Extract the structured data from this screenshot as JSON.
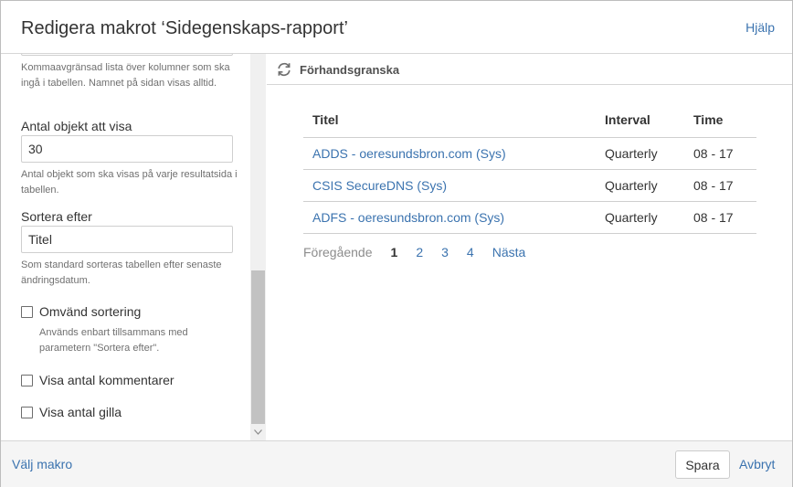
{
  "header": {
    "title": "Redigera makrot ‘Sidegenskaps-rapport’",
    "help": "Hjälp"
  },
  "left": {
    "columns_desc": "Kommaavgränsad lista över kolumner som ska ingå i tabellen. Namnet på sidan visas alltid.",
    "count_label": "Antal objekt att visa",
    "count_value": "30",
    "count_desc": "Antal objekt som ska visas på varje resultatsida i tabellen.",
    "sort_label": "Sortera efter",
    "sort_value": "Titel",
    "sort_desc": "Som standard sorteras tabellen efter senaste ändringsdatum.",
    "reverse_label": "Omvänd sortering",
    "reverse_desc": "Används enbart tillsammans med parametern \"Sortera efter\".",
    "comments_label": "Visa antal kommentarer",
    "likes_label": "Visa antal gilla"
  },
  "preview": {
    "title": "Förhandsgranska",
    "columns": [
      "Titel",
      "Interval",
      "Time"
    ],
    "rows": [
      {
        "title": "ADDS - oeresundsbron.com (Sys)",
        "interval": "Quarterly",
        "time": "08 - 17"
      },
      {
        "title": "CSIS SecureDNS (Sys)",
        "interval": "Quarterly",
        "time": "08 - 17"
      },
      {
        "title": "ADFS - oeresundsbron.com (Sys)",
        "interval": "Quarterly",
        "time": "08 - 17"
      }
    ],
    "pagination": {
      "prev": "Föregående",
      "pages": [
        "1",
        "2",
        "3",
        "4"
      ],
      "next": "Nästa"
    }
  },
  "footer": {
    "select_macro": "Välj makro",
    "save": "Spara",
    "cancel": "Avbryt"
  },
  "colors": {
    "link": "#3b73af",
    "text": "#333333",
    "border": "#d6d6d6"
  }
}
